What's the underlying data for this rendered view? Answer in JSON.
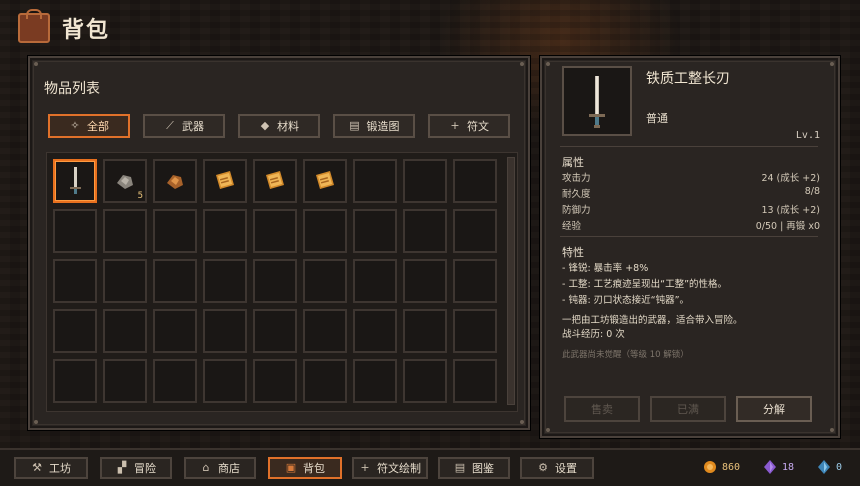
{
  "header": {
    "title": "背包"
  },
  "inventory": {
    "panel_title": "物品列表",
    "filters": [
      {
        "label": "全部",
        "icon": "compass-icon",
        "active": true
      },
      {
        "label": "武器",
        "icon": "sword-icon",
        "active": false
      },
      {
        "label": "材料",
        "icon": "ore-icon",
        "active": false
      },
      {
        "label": "锻造图",
        "icon": "book-icon",
        "active": false
      },
      {
        "label": "符文",
        "icon": "plus-icon",
        "active": false
      }
    ],
    "slots": [
      {
        "item": "sword",
        "qty": ""
      },
      {
        "item": "ore",
        "qty": "5"
      },
      {
        "item": "copper-ore",
        "qty": ""
      },
      {
        "item": "scroll",
        "qty": ""
      },
      {
        "item": "scroll",
        "qty": ""
      },
      {
        "item": "scroll",
        "qty": ""
      }
    ],
    "columns": 9,
    "rows": 5
  },
  "detail": {
    "name": "铁质工整长刃",
    "rarity": "普通",
    "level": "Lv.1",
    "attributes_title": "属性",
    "stats": [
      {
        "label": "攻击力",
        "value": "24 (成长 +2)"
      },
      {
        "label": "耐久度",
        "value": "8/8"
      },
      {
        "label": "防御力",
        "value": "13 (成长 +2)"
      },
      {
        "label": "经验",
        "value": "0/50 | 再锻 x0"
      }
    ],
    "traits_title": "特性",
    "traits": [
      "- 锋锐: 暴击率 +8%",
      "- 工整: 工艺痕迹呈现出“工整”的性格。",
      "- 钝器: 刃口状态接近“钝器”。"
    ],
    "description": [
      "一把由工坊锻造出的武器，适合带入冒险。",
      "战斗经历: 0 次"
    ],
    "hint": "此武器尚未觉醒（等级 10 解锁）",
    "buttons": [
      {
        "label": "售卖",
        "enabled": false
      },
      {
        "label": "已满",
        "enabled": false
      },
      {
        "label": "分解",
        "enabled": true
      }
    ]
  },
  "nav": {
    "items": [
      {
        "label": "工坊",
        "icon": "anvil-icon",
        "active": false
      },
      {
        "label": "冒险",
        "icon": "boot-icon",
        "active": false
      },
      {
        "label": "商店",
        "icon": "shop-icon",
        "active": false
      },
      {
        "label": "背包",
        "icon": "bag-icon",
        "active": true
      },
      {
        "label": "符文绘制",
        "icon": "plus-icon",
        "active": false
      },
      {
        "label": "图鉴",
        "icon": "book-icon",
        "active": false
      },
      {
        "label": "设置",
        "icon": "gear-icon",
        "active": false
      }
    ]
  },
  "resources": [
    {
      "name": "gold",
      "value": "860",
      "color": "#e08a1e"
    },
    {
      "name": "crystal",
      "value": "18",
      "color": "#8a5ad0"
    },
    {
      "name": "soul",
      "value": "0",
      "color": "#5aa0d0"
    }
  ]
}
